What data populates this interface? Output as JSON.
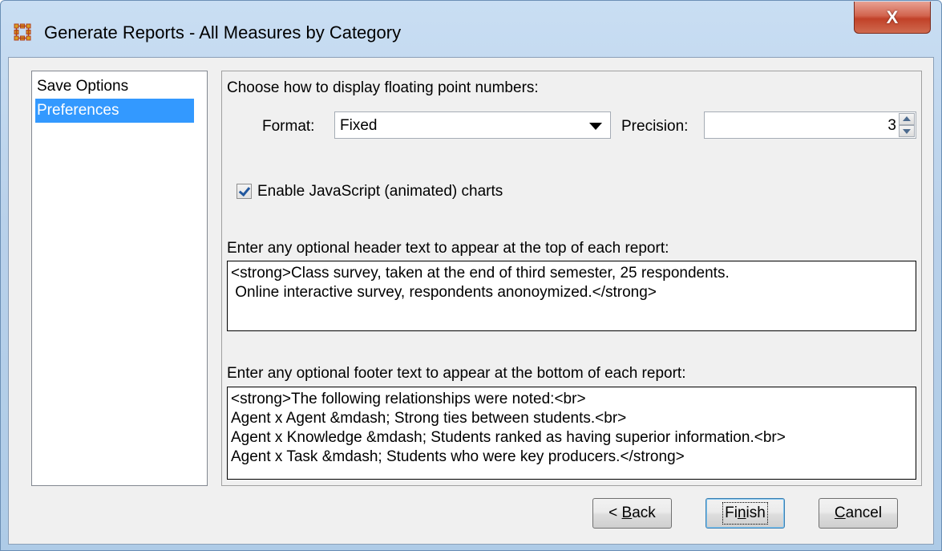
{
  "window": {
    "title": "Generate Reports - All Measures by Category",
    "close_label": "X"
  },
  "nav": {
    "items": [
      {
        "label": "Save Options",
        "selected": false
      },
      {
        "label": "Preferences",
        "selected": true
      }
    ]
  },
  "preferences": {
    "float_prompt": "Choose how to display floating point numbers:",
    "format_label": "Format:",
    "format_value": "Fixed",
    "precision_label": "Precision:",
    "precision_value": "3",
    "js_charts_label": "Enable JavaScript (animated) charts",
    "js_charts_checked": true,
    "header_prompt": "Enter any optional header text to appear at the top of each report:",
    "header_lines": [
      "<strong>Class survey, taken at the end of third semester, 25 respondents.",
      " Online interactive survey, respondents anonoymized.</strong>"
    ],
    "footer_prompt": "Enter any optional footer text to appear at the bottom of each report:",
    "footer_lines": [
      "<strong>The following relationships were noted:<br>",
      "Agent x Agent &mdash; Strong ties between students.<br>",
      "Agent x Knowledge &mdash; Students ranked as having superior information.<br>",
      "Agent x Task &mdash; Students who were key producers.</strong>"
    ]
  },
  "buttons": {
    "back": {
      "before": "< ",
      "mnemonic": "B",
      "after": "ack"
    },
    "finish": {
      "before": "Fi",
      "mnemonic": "n",
      "after": "ish"
    },
    "cancel": {
      "before": "",
      "mnemonic": "C",
      "after": "ancel"
    }
  },
  "colors": {
    "selection": "#3399ff",
    "close_button": "#c14128",
    "check_mark": "#21579e"
  }
}
